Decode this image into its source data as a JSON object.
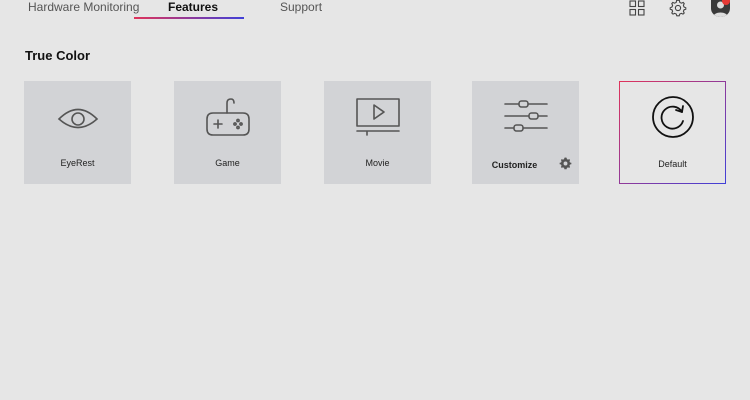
{
  "tabs": {
    "hardware_monitoring": "Hardware Monitoring",
    "features": "Features",
    "support": "Support",
    "active": "features"
  },
  "colors": {
    "background": "#e6e6e6",
    "card": "#d2d3d6",
    "accent_start": "#e0335a",
    "accent_end": "#4040d8",
    "notification": "#e53935"
  },
  "header_icons": [
    "grid-icon",
    "gear-icon",
    "avatar"
  ],
  "section": {
    "title": "True Color"
  },
  "cards": {
    "eyerest": {
      "label": "EyeRest",
      "icon": "eye-icon"
    },
    "game": {
      "label": "Game",
      "icon": "gamepad-icon"
    },
    "movie": {
      "label": "Movie",
      "icon": "monitor-play-icon"
    },
    "customize": {
      "label": "Customize",
      "icon": "sliders-icon",
      "settings_icon": "gear-icon"
    },
    "default": {
      "label": "Default",
      "icon": "reset-icon",
      "selected": true
    }
  }
}
